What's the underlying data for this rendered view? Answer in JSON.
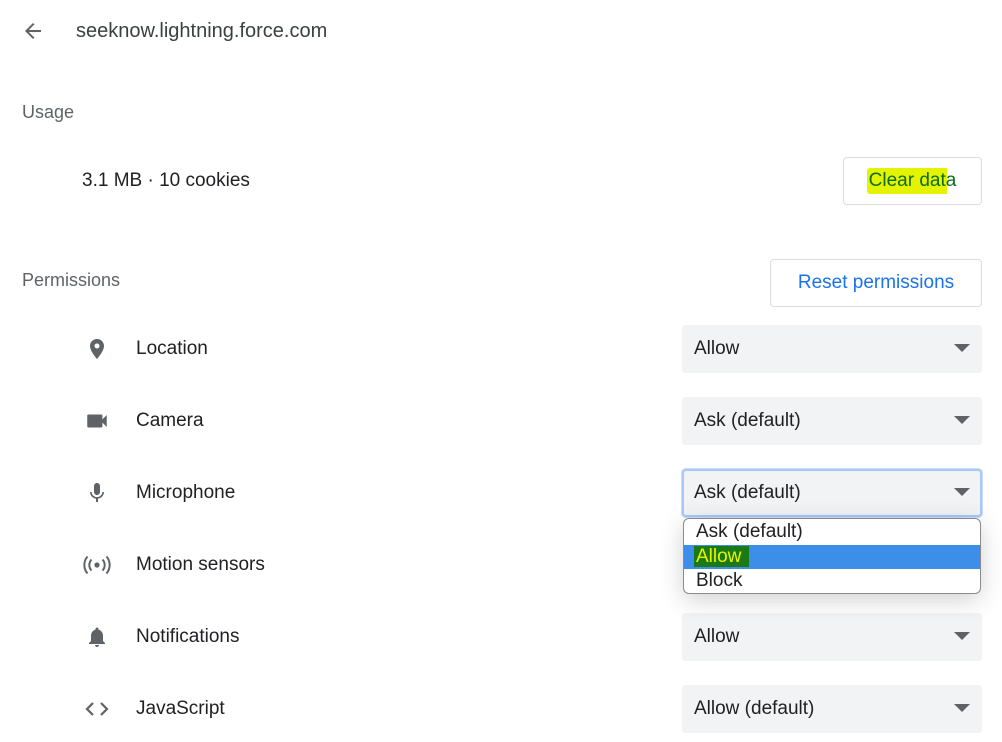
{
  "header": {
    "site": "seeknow.lightning.force.com"
  },
  "usage": {
    "heading": "Usage",
    "summary": "3.1 MB · 10 cookies",
    "clear_label": "Clear data"
  },
  "permissions": {
    "heading": "Permissions",
    "reset_label": "Reset permissions",
    "items": [
      {
        "label": "Location",
        "icon": "location-pin-icon",
        "value": "Allow"
      },
      {
        "label": "Camera",
        "icon": "camera-icon",
        "value": "Ask (default)"
      },
      {
        "label": "Microphone",
        "icon": "microphone-icon",
        "value": "Ask (default)"
      },
      {
        "label": "Motion sensors",
        "icon": "motion-sensors-icon",
        "value": ""
      },
      {
        "label": "Notifications",
        "icon": "bell-icon",
        "value": "Allow"
      },
      {
        "label": "JavaScript",
        "icon": "code-brackets-icon",
        "value": "Allow (default)"
      }
    ]
  },
  "dropdown": {
    "options": [
      "Ask (default)",
      "Allow",
      "Block"
    ],
    "highlighted": "Allow"
  },
  "colors": {
    "accent": "#1a73e8",
    "select_bg": "#f1f3f4",
    "option_selected": "#3d8ee8",
    "annotation_yellow": "#e4f400"
  }
}
